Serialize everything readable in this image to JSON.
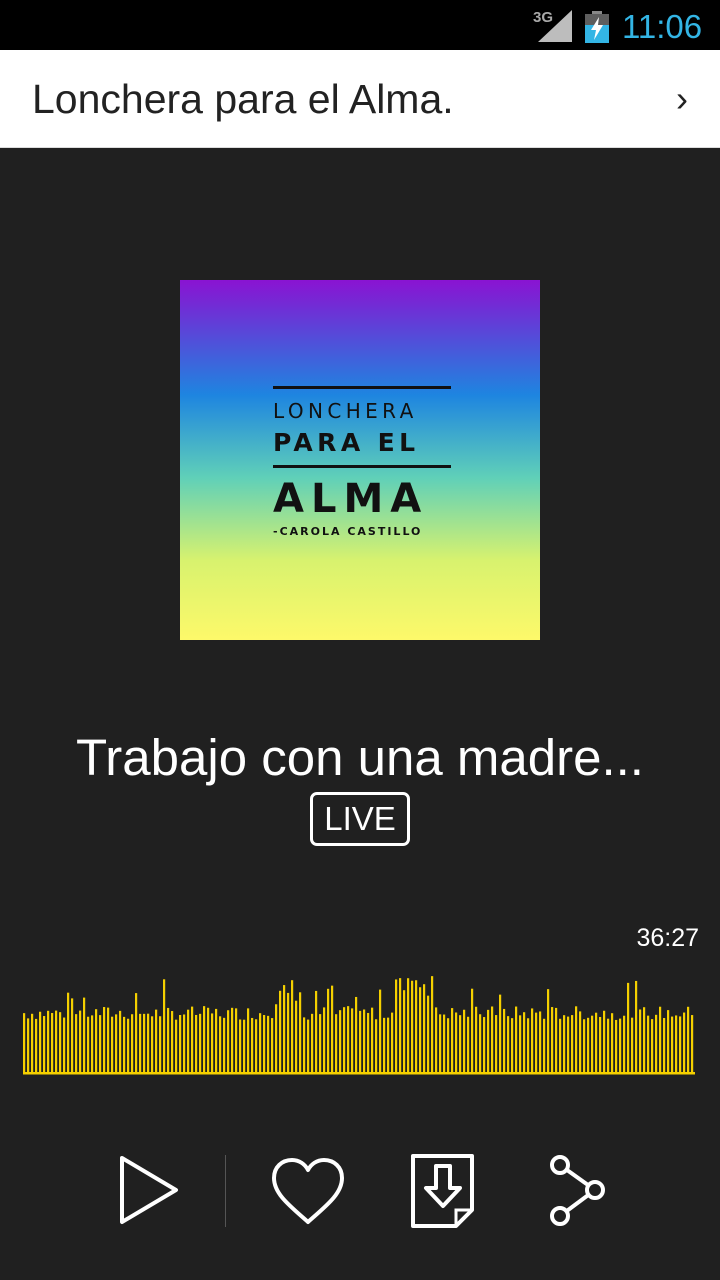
{
  "status_bar": {
    "network": "3G",
    "time": "11:06",
    "icons": [
      "signal-icon",
      "battery-charging-icon"
    ]
  },
  "app_bar": {
    "title": "Lonchera para el Alma.",
    "chevron": "›",
    "icons": [
      "chevron-right-icon"
    ]
  },
  "cover_art": {
    "line1": "LONCHERA",
    "line2": "PARA EL",
    "line3": "ALMA",
    "line4": "-CAROLA CASTILLO",
    "gradient_colors": [
      "#8a13d2",
      "#1e85e0",
      "#60d0b8",
      "#d8f26e",
      "#fdf96a"
    ]
  },
  "episode": {
    "title": "Trabajo con una madre...",
    "badge": "LIVE"
  },
  "player": {
    "duration": "36:27",
    "waveform_color": "#f5d000"
  },
  "controls": {
    "icons": [
      "play-icon",
      "heart-icon",
      "download-icon",
      "share-icon"
    ]
  },
  "colors": {
    "background": "#202020",
    "status_bar": "#000000",
    "clock": "#33b5e5",
    "app_bar": "#ffffff"
  }
}
